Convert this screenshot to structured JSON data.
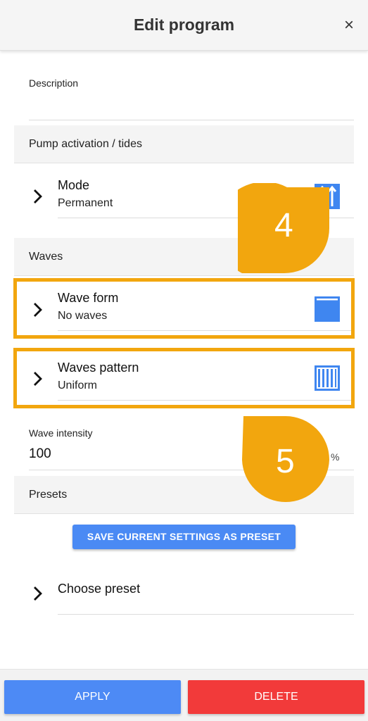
{
  "header": {
    "title": "Edit program",
    "close_glyph": "×"
  },
  "description": {
    "label": "Description",
    "value": ""
  },
  "sections": {
    "pump": "Pump activation / tides",
    "waves": "Waves",
    "presets": "Presets"
  },
  "mode_row": {
    "title": "Mode",
    "value": "Permanent",
    "icon": "tide-arrows-icon"
  },
  "wave_form_row": {
    "title": "Wave form",
    "value": "No waves",
    "icon": "square-wave-icon"
  },
  "waves_pattern_row": {
    "title": "Waves pattern",
    "value": "Uniform",
    "icon": "uniform-bars-icon"
  },
  "wave_intensity": {
    "label": "Wave intensity",
    "value": "100",
    "unit": "%"
  },
  "presets": {
    "save_button": "SAVE CURRENT SETTINGS AS PRESET",
    "choose_label": "Choose preset"
  },
  "footer": {
    "apply": "APPLY",
    "delete": "DELETE"
  },
  "callouts": {
    "first": "4",
    "second": "5"
  },
  "colors": {
    "accent_blue": "#4a8af4",
    "delete_red": "#f23a3a",
    "highlight_orange": "#f2a60e",
    "icon_blue": "#3f86f0"
  }
}
